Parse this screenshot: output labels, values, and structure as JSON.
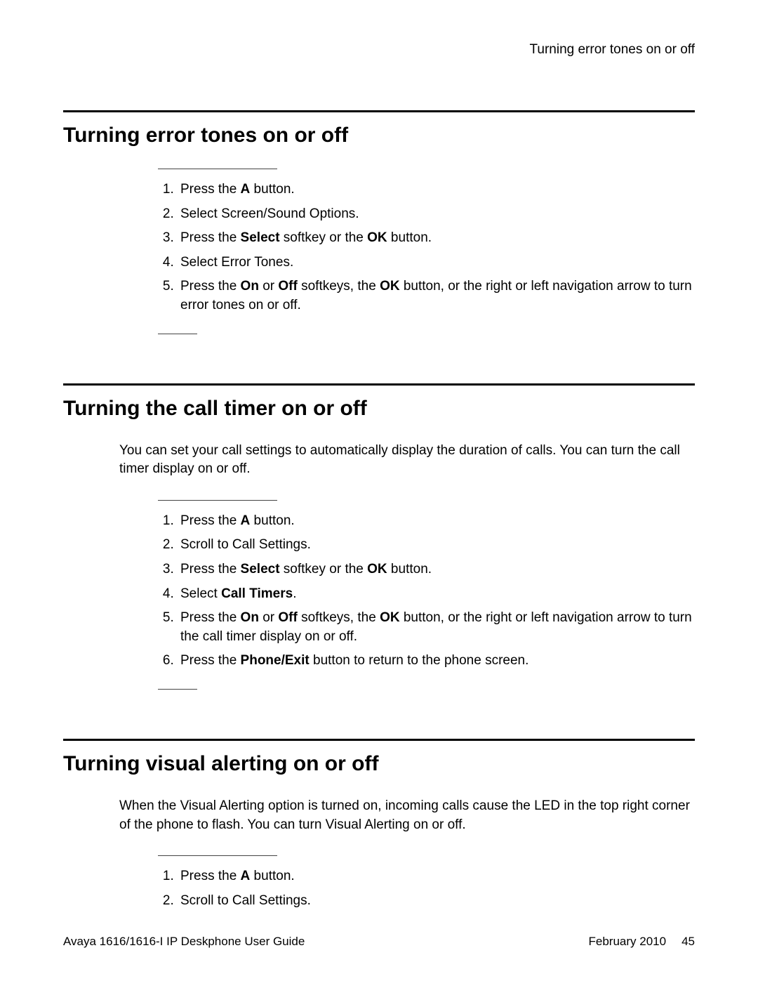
{
  "running_header": "Turning error tones on or off",
  "sections": [
    {
      "title": "Turning error tones on or off",
      "intro": "",
      "steps": [
        [
          {
            "t": "Press the "
          },
          {
            "t": "A",
            "b": true
          },
          {
            "t": " button."
          }
        ],
        [
          {
            "t": "Select Screen/Sound Options."
          }
        ],
        [
          {
            "t": "Press the "
          },
          {
            "t": "Select",
            "b": true
          },
          {
            "t": " softkey or the "
          },
          {
            "t": "OK",
            "b": true
          },
          {
            "t": " button."
          }
        ],
        [
          {
            "t": "Select Error Tones."
          }
        ],
        [
          {
            "t": "Press the "
          },
          {
            "t": "On",
            "b": true
          },
          {
            "t": " or "
          },
          {
            "t": "Off",
            "b": true
          },
          {
            "t": " softkeys, the "
          },
          {
            "t": "OK",
            "b": true
          },
          {
            "t": " button, or the right or left navigation arrow to turn error tones on or off."
          }
        ]
      ]
    },
    {
      "title": "Turning the call timer on or off",
      "intro": "You can set your call settings to automatically display the duration of calls. You can turn the call timer display on or off.",
      "steps": [
        [
          {
            "t": "Press the "
          },
          {
            "t": "A",
            "b": true
          },
          {
            "t": " button."
          }
        ],
        [
          {
            "t": "Scroll to Call Settings."
          }
        ],
        [
          {
            "t": "Press the "
          },
          {
            "t": "Select",
            "b": true
          },
          {
            "t": " softkey or the "
          },
          {
            "t": "OK",
            "b": true
          },
          {
            "t": " button."
          }
        ],
        [
          {
            "t": "Select "
          },
          {
            "t": "Call Timers",
            "b": true
          },
          {
            "t": "."
          }
        ],
        [
          {
            "t": "Press the "
          },
          {
            "t": "On",
            "b": true
          },
          {
            "t": " or "
          },
          {
            "t": "Off",
            "b": true
          },
          {
            "t": " softkeys, the "
          },
          {
            "t": "OK",
            "b": true
          },
          {
            "t": " button, or the right or left navigation arrow to turn the call timer display on or off."
          }
        ],
        [
          {
            "t": "Press the "
          },
          {
            "t": "Phone/Exit",
            "b": true
          },
          {
            "t": " button to return to the phone screen."
          }
        ]
      ]
    },
    {
      "title": "Turning visual alerting on or off",
      "intro": "When the Visual Alerting option is turned on, incoming calls cause the LED in the top right corner of the phone to flash. You can turn Visual Alerting on or off.",
      "steps": [
        [
          {
            "t": "Press the "
          },
          {
            "t": "A",
            "b": true
          },
          {
            "t": " button."
          }
        ],
        [
          {
            "t": "Scroll to Call Settings."
          }
        ]
      ]
    }
  ],
  "footer": {
    "left": "Avaya 1616/1616-I IP Deskphone User Guide",
    "right_date": "February 2010",
    "page_number": "45"
  }
}
